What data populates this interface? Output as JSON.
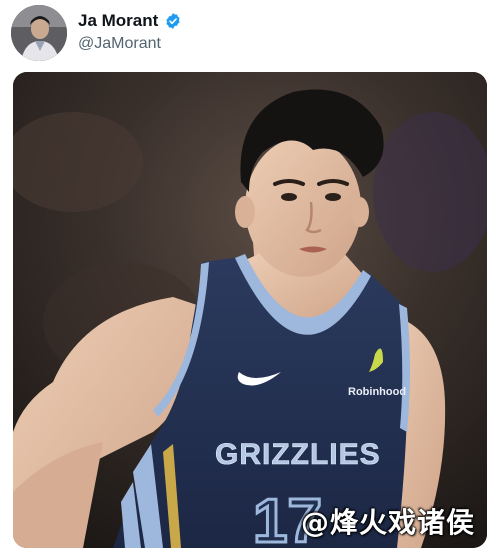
{
  "tweet": {
    "author": {
      "display_name": "Ja Morant",
      "handle": "@JaMorant",
      "verified": true,
      "avatar_icon": "profile-avatar"
    },
    "media": {
      "image_icon": "basketball-player-photo",
      "jersey": {
        "team_text": "GRIZZLIES",
        "number": "17",
        "sponsor": "Robinhood",
        "brand_icon": "nike-swoosh-icon"
      }
    },
    "watermark": "@烽火戏诸侯"
  },
  "colors": {
    "verified_blue": "#1d9bf0",
    "jersey_navy": "#22304f",
    "jersey_trim": "#9db8dc"
  }
}
